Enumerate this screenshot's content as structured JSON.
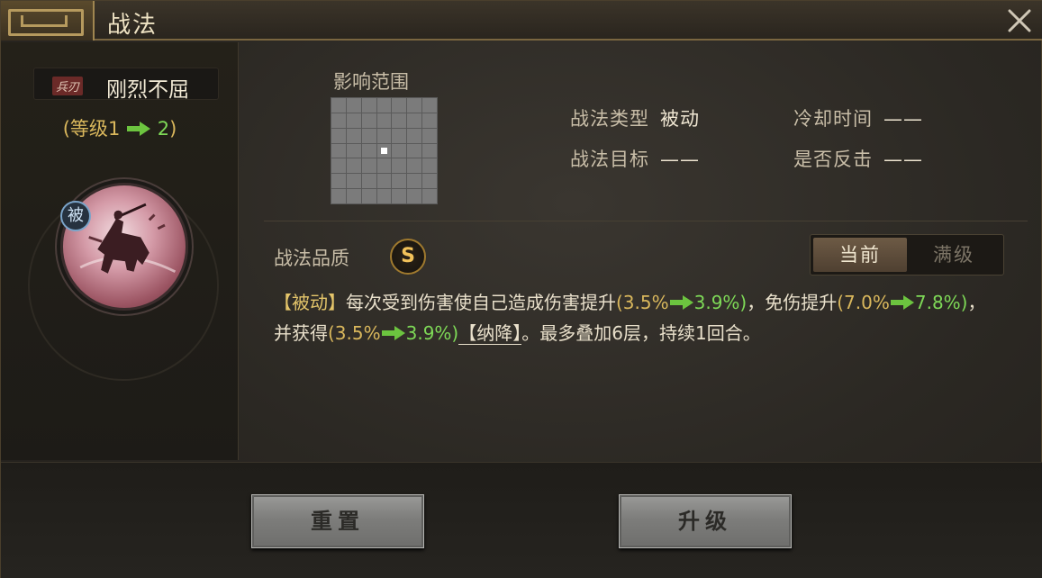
{
  "window": {
    "title": "战法"
  },
  "skill": {
    "weapon_tag": "兵刃",
    "name": "刚烈不屈",
    "level_open": "(等级",
    "level_from": "1",
    "level_to": "2",
    "level_close": ")",
    "type_badge": "被"
  },
  "range": {
    "label": "影响范围",
    "grid_size": 7,
    "highlight_cell": [
      3,
      3
    ]
  },
  "info": {
    "type_label": "战法类型",
    "type_value": "被动",
    "cooldown_label": "冷却时间",
    "cooldown_value": "——",
    "target_label": "战法目标",
    "target_value": "——",
    "counter_label": "是否反击",
    "counter_value": "——"
  },
  "quality": {
    "label": "战法品质",
    "grade": "S"
  },
  "toggle": {
    "current": "当前",
    "max": "满级",
    "selected": "current"
  },
  "description": {
    "tag": "【被动】",
    "p1": "每次受到伤害使自己造成伤害提升",
    "v1_open": "(3.5%",
    "v1_to": "3.9%)",
    "p2": "，免伤提升",
    "v2_open": "(7.0%",
    "v2_to": "7.8%)",
    "p3": "，并获得",
    "v3_open": "(3.5%",
    "v3_to": "3.9%)",
    "status": "【纳降】",
    "p4": "。最多叠加6层，持续1回合。"
  },
  "buttons": {
    "reset": "重置",
    "upgrade": "升级"
  },
  "colors": {
    "gold": "#d9b75c",
    "green": "#7ed957",
    "accent_badge": "#f2c25a"
  }
}
